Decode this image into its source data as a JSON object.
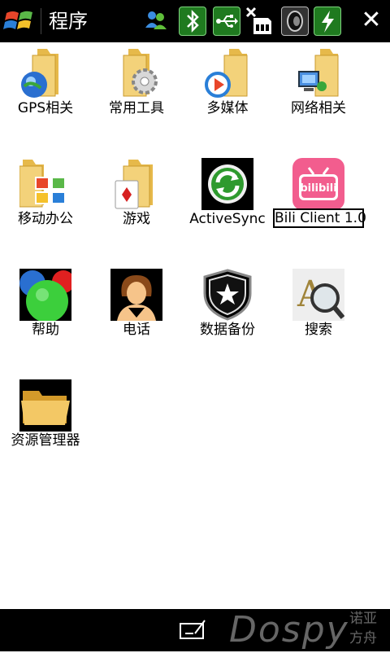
{
  "titlebar": {
    "title": "程序",
    "start_icon": "windows-start-icon",
    "status_icons": [
      "messenger-icon",
      "bluetooth-icon",
      "usb-icon",
      "no-sim-icon",
      "speaker-icon",
      "battery-charging-icon"
    ],
    "close_icon": "close-icon"
  },
  "apps": [
    {
      "label": "GPS相关",
      "icon": "gps-folder-icon"
    },
    {
      "label": "常用工具",
      "icon": "tools-folder-icon"
    },
    {
      "label": "多媒体",
      "icon": "multimedia-folder-icon"
    },
    {
      "label": "网络相关",
      "icon": "network-folder-icon"
    },
    {
      "label": "移动办公",
      "icon": "office-folder-icon"
    },
    {
      "label": "游戏",
      "icon": "games-folder-icon"
    },
    {
      "label": "ActiveSync",
      "icon": "activesync-icon"
    },
    {
      "label": "Bili Client 1.0",
      "icon": "bilibili-icon",
      "selected": true
    },
    {
      "label": "帮助",
      "icon": "help-icon"
    },
    {
      "label": "电话",
      "icon": "phone-icon"
    },
    {
      "label": "数据备份",
      "icon": "backup-icon"
    },
    {
      "label": "搜索",
      "icon": "search-icon"
    },
    {
      "label": "资源管理器",
      "icon": "file-explorer-icon"
    }
  ],
  "bottombar": {
    "keyboard_icon": "keyboard-icon",
    "watermark": "Dospy",
    "watermark_sub_1": "诺亚",
    "watermark_sub_2": "方舟"
  },
  "colors": {
    "bar": "#000000",
    "background": "#ffffff",
    "status_green": "#1f7a1f",
    "bilibili_pink": "#f25d8e"
  }
}
